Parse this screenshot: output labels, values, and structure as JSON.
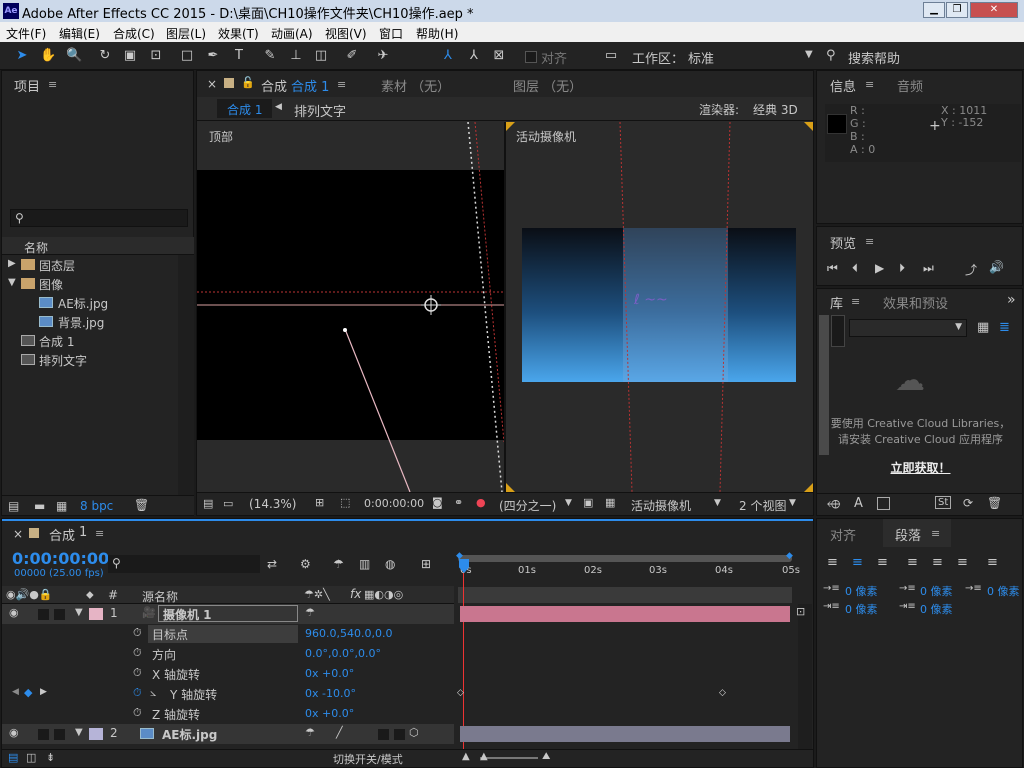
{
  "window": {
    "title": "Adobe After Effects CC 2015 - D:\\桌面\\CH10操作文件夹\\CH10操作.aep *",
    "logo": "Ae",
    "minimize": "▁",
    "restore": "❐",
    "close": "✕"
  },
  "menu": [
    "文件(F)",
    "编辑(E)",
    "合成(C)",
    "图层(L)",
    "效果(T)",
    "动画(A)",
    "视图(V)",
    "窗口",
    "帮助(H)"
  ],
  "toolbar": {
    "align_label": "对齐",
    "workspace_label": "工作区：",
    "workspace_value": "标准",
    "search_help": "搜索帮助",
    "workspace_arrow": "▼",
    "search_icon": "⚲",
    "more_icon": "»"
  },
  "project": {
    "tab": "项目",
    "menu_icon": "≡",
    "search_icon": "⚲",
    "col_name": "名称",
    "items": [
      {
        "name": "固态层",
        "type": "folder",
        "arrow": "▶"
      },
      {
        "name": "图像",
        "type": "folder",
        "arrow": "▼"
      },
      {
        "name": "AE标.jpg",
        "type": "image"
      },
      {
        "name": "背景.jpg",
        "type": "image"
      },
      {
        "name": "合成 1",
        "type": "comp"
      },
      {
        "name": "排列文字",
        "type": "comp"
      }
    ],
    "bpc": "8 bpc",
    "trash_icon": "🗑"
  },
  "comp_panel": {
    "close": "×",
    "lock_icon": "🔓",
    "tab_prefix": "合成",
    "tab_name": "合成 1",
    "footage_tab": "素材 （无）",
    "layer_tab": "图层 （无）",
    "breadcrumb_active": "合成 1",
    "breadcrumb_next": "排列文字",
    "breadcrumb_arrow": "◀",
    "renderer_label": "渲染器:",
    "renderer_value": "经典 3D",
    "view_left": "顶部",
    "view_right": "活动摄像机",
    "zoom": "(14.3%)",
    "timecode": "0:00:00:00",
    "resolution": "(四分之一)",
    "camera": "活动摄像机",
    "views": "2 个视图",
    "dropdown_arrow": "▼"
  },
  "info": {
    "tab": "信息",
    "audio_tab": "音频",
    "menu_icon": "≡",
    "R": "R :",
    "G": "G :",
    "B": "B :",
    "A": "A : 0",
    "X": "X : 1011",
    "Y": "Y : -152",
    "crosshair": "+"
  },
  "preview": {
    "tab": "预览",
    "menu_icon": "≡",
    "buttons": [
      "⏮",
      "⏴",
      "▶",
      "⏵",
      "⏭",
      "⤴",
      "🔊"
    ]
  },
  "library": {
    "tab": "库",
    "effects_tab": "效果和预设",
    "menu_icon": "≡",
    "more_icon": "»",
    "msg1": "要使用 Creative Cloud Libraries，",
    "msg2": "请安装 Creative Cloud 应用程序",
    "link": "立即获取！",
    "footer_a": "A",
    "footer_st": "St"
  },
  "paragraph": {
    "align_tab": "对齐",
    "para_tab": "段落",
    "menu_icon": "≡",
    "fields": [
      "0 像素",
      "0 像素",
      "0 像素",
      "0 像素",
      "0 像素"
    ]
  },
  "timeline": {
    "close": "×",
    "tab": "合成",
    "tab_num": "1",
    "menu_icon": "≡",
    "timecode": "0:00:00:00",
    "fps": "00000 (25.00 fps)",
    "search_icon": "⚲",
    "col_hash": "#",
    "col_source": "源名称",
    "col_fx": "fx",
    "ruler": [
      "0s",
      "01s",
      "02s",
      "03s",
      "04s",
      "05s"
    ],
    "layers": [
      {
        "num": "1",
        "name": "摄像机 1",
        "color": "#e6b4c5"
      },
      {
        "num": "2",
        "name": "AE标.jpg",
        "color": "#b6b4d8"
      }
    ],
    "props": [
      {
        "name": "目标点",
        "value": "960.0,540.0,0.0"
      },
      {
        "name": "方向",
        "value": "0.0°,0.0°,0.0°"
      },
      {
        "name": "X 轴旋转",
        "value": "0x +0.0°"
      },
      {
        "name": "Y 轴旋转",
        "value": "0x -10.0°"
      },
      {
        "name": "Z 轴旋转",
        "value": "0x +0.0°"
      }
    ],
    "toggle_mode": "切换开关/模式",
    "stopwatch": "⏱",
    "keyframe": "◆",
    "prev": "◀",
    "next": "▶",
    "expand_arrow": "▼"
  }
}
